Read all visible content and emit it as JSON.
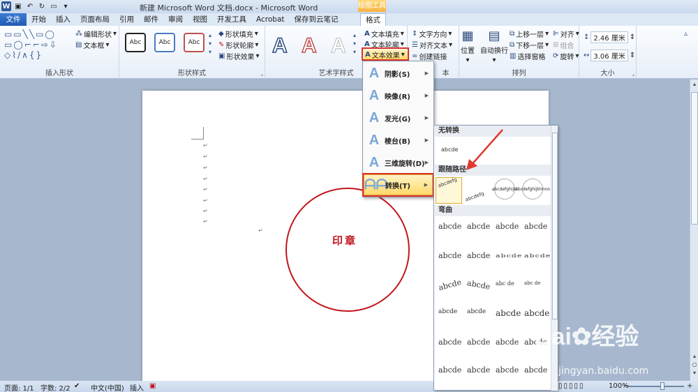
{
  "window": {
    "title": "新建 Microsoft Word 文档.docx - Microsoft Word",
    "context_tools": "绘图工具"
  },
  "tabs": [
    "文件",
    "开始",
    "插入",
    "页面布局",
    "引用",
    "邮件",
    "审阅",
    "视图",
    "开发工具",
    "Acrobat",
    "保存到云笔记",
    "格式"
  ],
  "ribbon": {
    "insert_shapes": {
      "edit_shape": "编辑形状",
      "text_box": "文本框",
      "label": "插入形状"
    },
    "shape_styles": {
      "style_sample": "Abc",
      "fill": "形状填充",
      "outline": "形状轮廓",
      "effects": "形状效果",
      "label": "形状样式"
    },
    "wordart": {
      "text_fill": "文本填充",
      "text_outline": "文本轮廓",
      "text_effects": "文本效果",
      "label": "艺术字样式"
    },
    "text": {
      "direction": "文字方向",
      "align": "对齐文本",
      "link": "创建链接",
      "label_tail": "本"
    },
    "arrange": {
      "position": "位置",
      "wrap": "自动换行",
      "forward": "上移一层",
      "backward": "下移一层",
      "selection_pane": "选择窗格",
      "align": "对齐",
      "group": "组合",
      "rotate": "旋转",
      "label": "排列"
    },
    "size": {
      "height": "2.46 厘米",
      "width": "3.06 厘米",
      "label": "大小"
    }
  },
  "text_effects_menu": [
    {
      "label": "阴影(S)"
    },
    {
      "label": "映像(R)"
    },
    {
      "label": "发光(G)"
    },
    {
      "label": "棱台(B)"
    },
    {
      "label": "三维旋转(D)"
    },
    {
      "label": "转换(T)"
    }
  ],
  "gallery": {
    "no_transform": "无转换",
    "no_transform_sample": "abcde",
    "follow_path": "跟随路径",
    "path_samples": [
      "abcdefg",
      "abcdefg",
      "abcdefghijkl",
      "abcdefghijklmno"
    ],
    "warp": "弯曲",
    "warp_sample": "abcde",
    "warp_circle": "abc de"
  },
  "document": {
    "seal_text": "印章",
    "paragraph_mark": "↵"
  },
  "status": {
    "page": "页面: 1/1",
    "words": "字数: 2/2",
    "language": "中文(中国)",
    "mode": "插入",
    "zoom": "100%"
  },
  "watermark": {
    "brand": "Bai",
    "brand2": "经验",
    "url": "jingyan.baidu.com"
  },
  "colors": {
    "seal": "#c1161c",
    "highlight": "#d9342b",
    "ribbon_blue": "#2b5797"
  }
}
